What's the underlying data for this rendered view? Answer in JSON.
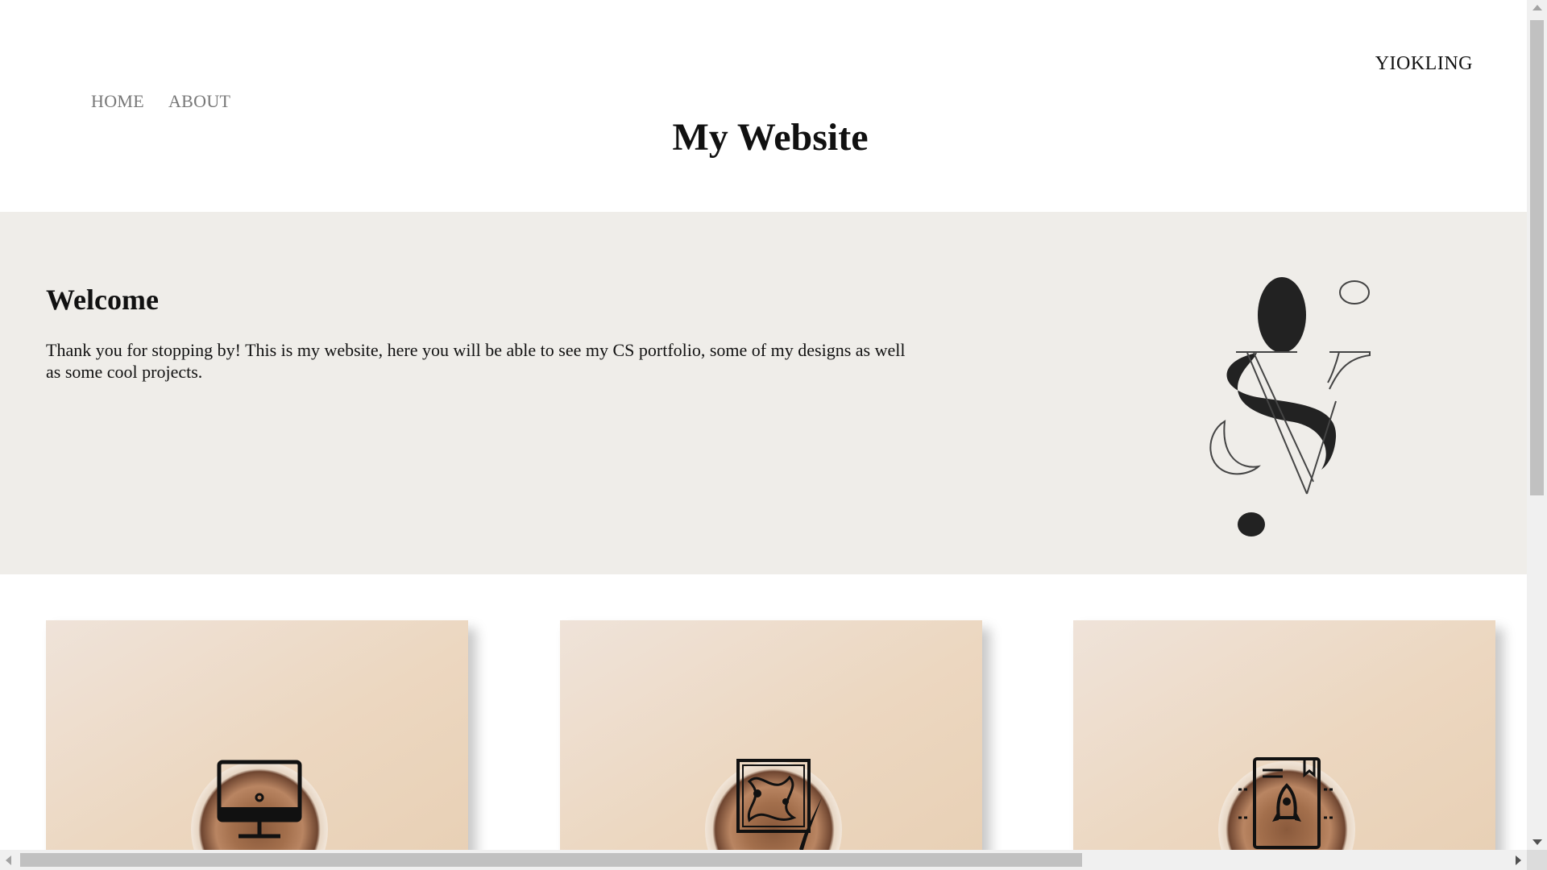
{
  "header": {
    "brand": "YIOKLING",
    "title": "My Website",
    "nav": [
      {
        "label": "HOME"
      },
      {
        "label": "ABOUT"
      }
    ]
  },
  "hero": {
    "heading": "Welcome",
    "text": "Thank you for stopping by! This is my website, here you will be able to see my CS portfolio, some of my designs as well as some cool projects.",
    "logo_icon": "yl-monogram-logo"
  },
  "cards": [
    {
      "icon": "computer-icon"
    },
    {
      "icon": "art-canvas-brush-icon"
    },
    {
      "icon": "rocket-book-icon"
    }
  ],
  "colors": {
    "hero_bg": "#efede9",
    "nav_text": "#777777",
    "card_bg": "#ecd7c0"
  }
}
